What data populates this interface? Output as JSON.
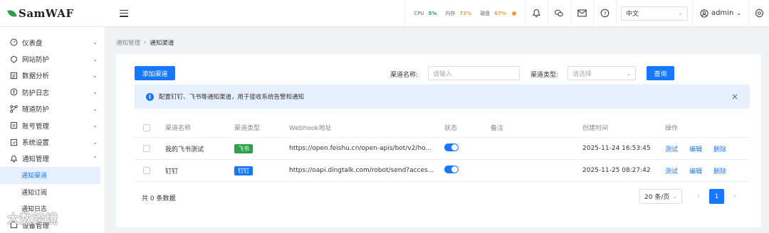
{
  "app": {
    "logo_text": "SamWAF",
    "logo_color": "#2e9f4a"
  },
  "topbar": {
    "stats": [
      {
        "label": "CPU",
        "value": "5%",
        "color": "#2e9f4a"
      },
      {
        "label": "内存",
        "value": "73%",
        "color": "#e6a23c"
      },
      {
        "label": "磁盘",
        "value": "67%",
        "color": "#e6a23c"
      }
    ],
    "language": "中文",
    "user": "admin",
    "icons": [
      "bell-icon",
      "wechat-icon",
      "mail-icon",
      "help-icon",
      "settings-icon"
    ]
  },
  "sidebar": {
    "items": [
      {
        "label": "仪表盘",
        "icon": "dashboard-icon",
        "expanded": false
      },
      {
        "label": "网站防护",
        "icon": "shield-icon",
        "expanded": false
      },
      {
        "label": "数据分析",
        "icon": "chart-icon",
        "expanded": false
      },
      {
        "label": "防护日志",
        "icon": "log-icon",
        "expanded": false
      },
      {
        "label": "隧道防护",
        "icon": "tunnel-icon",
        "expanded": false
      },
      {
        "label": "账号管理",
        "icon": "account-icon",
        "expanded": false
      },
      {
        "label": "系统设置",
        "icon": "system-icon",
        "expanded": false
      },
      {
        "label": "通知管理",
        "icon": "notification-icon",
        "expanded": true
      }
    ],
    "sub_items": [
      {
        "label": "通知渠道",
        "active": true
      },
      {
        "label": "通知订阅",
        "active": false
      },
      {
        "label": "通知日志",
        "active": false
      }
    ],
    "last_item": {
      "label": "设备管理"
    }
  },
  "breadcrumb": {
    "parent": "通知管理",
    "current": "通知渠道"
  },
  "toolbar": {
    "add_button": "添加渠道",
    "name_label": "渠道名称:",
    "name_placeholder": "请输入",
    "type_label": "渠道类型:",
    "type_placeholder": "请选择",
    "query_button": "查询"
  },
  "alert": {
    "text": "配置钉钉、飞书等通知渠道，用于接收系统告警和通知"
  },
  "table": {
    "headers": [
      "渠道名称",
      "渠道类型",
      "Webhook地址",
      "状态",
      "备注",
      "创建时间",
      "操作"
    ],
    "rows": [
      {
        "name": "我的飞书测试",
        "type": "飞书",
        "type_color": "#2e9f4a",
        "webhook": "https://open.feishu.cn/open-apis/bot/v2/ho...",
        "enabled": true,
        "remark": "",
        "created": "2025-11-24 16:53:45",
        "actions": [
          "测试",
          "编辑",
          "删除"
        ]
      },
      {
        "name": "钉钉",
        "type": "钉钉",
        "type_color": "#1677ff",
        "webhook": "https://oapi.dingtalk.com/robot/send?acces...",
        "enabled": true,
        "remark": "",
        "created": "2025-11-25 08:27:42",
        "actions": [
          "测试",
          "编辑",
          "删除"
        ]
      }
    ]
  },
  "pagination": {
    "total_text": "共 0 条数据",
    "page_size": "20 条/页",
    "current_page": "1"
  },
  "watermark": "大数跨境",
  "accent_color": "#1677ff"
}
